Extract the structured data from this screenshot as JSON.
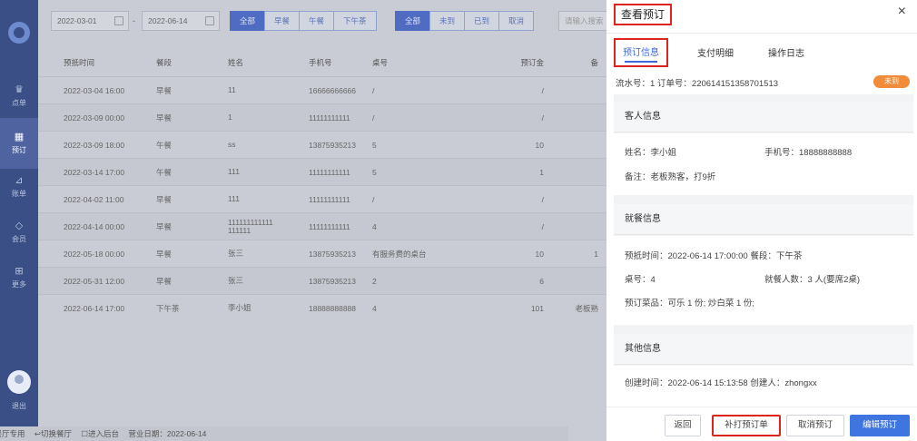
{
  "sidebar": {
    "logo": "app-logo",
    "items": [
      {
        "icon": "crown-icon",
        "glyph": "♛",
        "label": "点单"
      },
      {
        "icon": "calendar-icon",
        "glyph": "▦",
        "label": "预订"
      },
      {
        "icon": "chart-icon",
        "glyph": "⊿",
        "label": "账单"
      },
      {
        "icon": "diamond-icon",
        "glyph": "◇",
        "label": "会员"
      },
      {
        "icon": "grid-icon",
        "glyph": "⊞",
        "label": "更多"
      }
    ],
    "logout": "退出"
  },
  "filters": {
    "start_date": "2022-03-01",
    "date_sep": "-",
    "end_date": "2022-06-14",
    "meal": [
      "全部",
      "早餐",
      "午餐",
      "下午茶"
    ],
    "status": [
      "全部",
      "未到",
      "已到",
      "取消"
    ],
    "search_placeholder": "请输入搜索"
  },
  "table": {
    "headers": [
      "预抵时间",
      "餐段",
      "姓名",
      "手机号",
      "桌号",
      "预订金",
      "备"
    ],
    "rows": [
      [
        "2022-03-04 16:00",
        "早餐",
        "11",
        "16666666666",
        "/",
        "/",
        ""
      ],
      [
        "2022-03-09 00:00",
        "早餐",
        "1",
        "11111111111",
        "/",
        "/",
        ""
      ],
      [
        "2022-03-09 18:00",
        "午餐",
        "ss",
        "13875935213",
        "5",
        "10",
        ""
      ],
      [
        "2022-03-14 17:00",
        "午餐",
        "111",
        "11111111111",
        "5",
        "1",
        ""
      ],
      [
        "2022-04-02 11:00",
        "早餐",
        "111",
        "11111111111",
        "/",
        "/",
        ""
      ],
      [
        "2022-04-14 00:00",
        "早餐",
        "111111111111 111111",
        "11111111111",
        "4",
        "/",
        ""
      ],
      [
        "2022-05-18 00:00",
        "早餐",
        "张三",
        "13875935213",
        "有服务费的桌台",
        "10",
        "1"
      ],
      [
        "2022-05-31 12:00",
        "早餐",
        "张三",
        "13875935213",
        "2",
        "6",
        ""
      ],
      [
        "2022-06-14 17:00",
        "下午茶",
        "李小姐",
        "18888888888",
        "4",
        "101",
        "老板熟"
      ]
    ]
  },
  "footer": {
    "items": [
      "云丹茶餐厅专用",
      "↩切换餐厅",
      "☐进入后台",
      "营业日期：2022-06-14"
    ]
  },
  "drawer": {
    "title": "查看预订",
    "close": "×",
    "tabs": [
      "预订信息",
      "支付明细",
      "操作日志"
    ],
    "serial": "流水号：1  订单号：220614151358701513",
    "badge": "未到",
    "guest": {
      "header": "客人信息",
      "name": "姓名：李小姐",
      "phone": "手机号：18888888888",
      "note": "备注：老板熟客，打9折"
    },
    "dining": {
      "header": "就餐信息",
      "arrival": "预抵时间：2022-06-14 17:00:00 餐段：下午茶",
      "table": "桌号：4",
      "people": "就餐人数：3 人(要席2桌)",
      "dishes": "预订菜品：可乐 1 份; 炒白菜 1 份;"
    },
    "other": {
      "header": "其他信息",
      "created": "创建时间：2022-06-14 15:13:58 创建人：zhongxx"
    },
    "buttons": {
      "back": "返回",
      "reprint": "补打预订单",
      "cancel": "取消预订",
      "edit": "编辑预订"
    }
  }
}
